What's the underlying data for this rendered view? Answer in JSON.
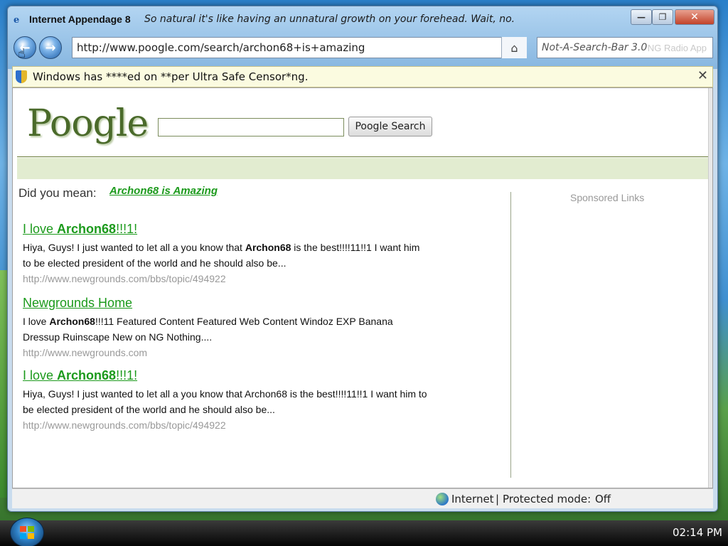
{
  "window": {
    "title": "Internet Appendage 8",
    "tagline": "So natural it's like having an unnatural growth on your forehead.  Wait, no...",
    "minimize": "—",
    "maximize": "❐",
    "close": "✕"
  },
  "navbar": {
    "back": "←",
    "forward": "→",
    "address": "http://www.poogle.com/search/archon68+is+amazing",
    "home_icon": "⌂",
    "search_placeholder": "Not-A-Search-Bar 3.0",
    "search_ghost_text": "NG Radio App"
  },
  "infobar": {
    "text": "Windows has ****ed on **per Ultra Safe Censor*ng.",
    "close": "✕"
  },
  "page": {
    "logo": "Poogle",
    "search_value": "",
    "search_button": "Poogle Search",
    "did_you_mean_label": "Did you mean:",
    "did_you_mean_link": "Archon68 is Amazing",
    "sponsored": "Sponsored Links",
    "results": [
      {
        "title_pre": "I love ",
        "title_bold": "Archon68",
        "title_post": "!!!1!",
        "snippet_pre": "Hiya, Guys!   I just wanted to let all a you know that ",
        "snippet_bold": "Archon68",
        "snippet_post": " is the best!!!!11!!1 I want him to be elected president of the world and he should also be...",
        "url": "http://www.newgrounds.com/bbs/topic/494922"
      },
      {
        "title_pre": "Newgrounds Home ",
        "title_bold": "",
        "title_post": "",
        "snippet_pre": "I love ",
        "snippet_bold": "Archon68",
        "snippet_post": "!!!11 Featured Content Featured Web Content Windoz EXP Banana Dressup Ruinscape New on NG Nothing....",
        "url": "http://www.newgrounds.com"
      },
      {
        "title_pre": "I love ",
        "title_bold": "Archon68",
        "title_post": "!!!1!",
        "snippet_pre": "Hiya, Guys!   I just wanted to let all a you know that Archon68 is the best!!!!11!!1 I want him to be elected president of the world and he should also be...",
        "snippet_bold": "",
        "snippet_post": "",
        "url": "http://www.newgrounds.com/bbs/topic/494922"
      }
    ]
  },
  "status": {
    "zone": "Internet",
    "separator": "|",
    "mode_label": "Protected mode:",
    "mode_value": "Off"
  },
  "taskbar": {
    "clock": "02:14 PM"
  },
  "colors": {
    "link_green": "#1c9a1c",
    "band_green": "#e2ecd0",
    "logo_green": "#4a6a2a"
  }
}
